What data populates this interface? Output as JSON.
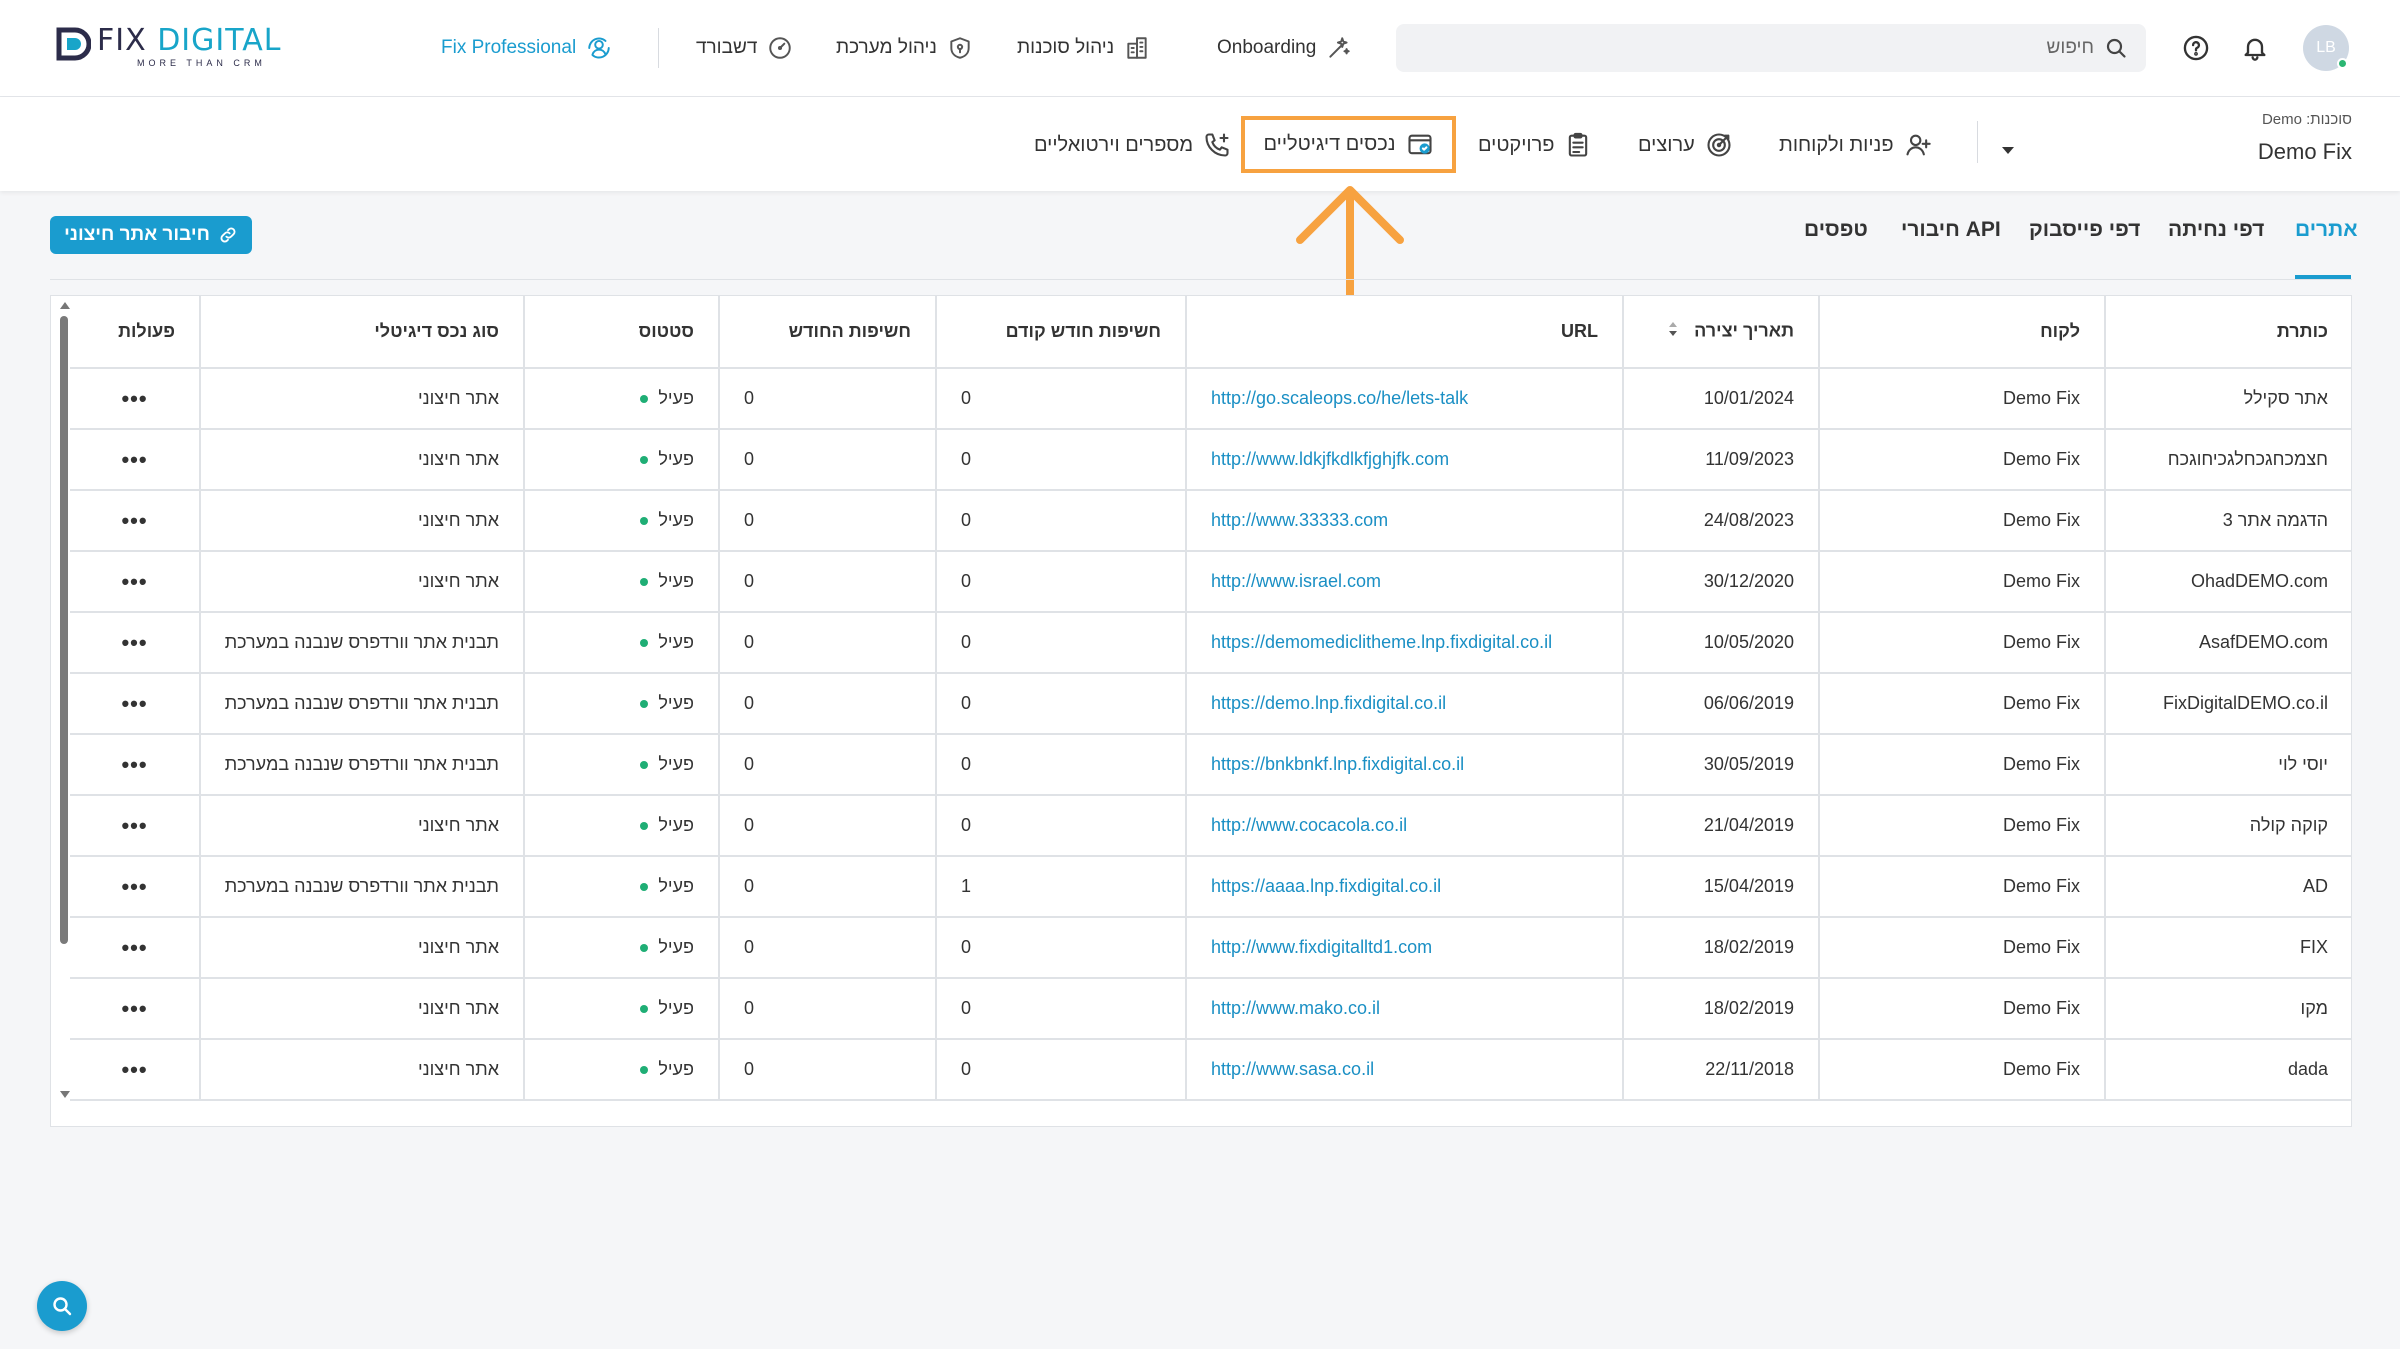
{
  "brand": {
    "name_part1": "FIX",
    "name_part2": "DIGITAL",
    "tagline": "MORE THAN CRM"
  },
  "topnav": {
    "pro_label": "Fix Professional",
    "dashboard_label": "דשבורד",
    "system_label": "ניהול מערכת",
    "agencies_label": "ניהול סוכנות",
    "onboarding_label": "Onboarding"
  },
  "search": {
    "placeholder": "חיפוש"
  },
  "user": {
    "initials": "LB"
  },
  "agency": {
    "label": "סוכנות: Demo",
    "name": "Demo Fix"
  },
  "subnav": {
    "leads_label": "פניות ולקוחות",
    "channels_label": "ערוצים",
    "projects_label": "פרויקטים",
    "assets_label": "נכסים דיגיטליים",
    "virtual_numbers_label": "מספרים וירטואליים"
  },
  "tabs": {
    "sites": "אתרים",
    "landing": "דפי נחיתה",
    "facebook": "דפי פייסבוק",
    "api": "חיבורי API",
    "forms": "טפסים"
  },
  "connect_button": "חיבור אתר חיצוני",
  "table": {
    "headers": {
      "title": "כותרת",
      "client": "לקוח",
      "created": "תאריך יצירה",
      "url": "URL",
      "prev_month": "חשיפות חודש קודם",
      "this_month": "חשיפות החודש",
      "status": "סטטוס",
      "type": "סוג נכס דיגיטלי",
      "actions": "פעולות"
    },
    "rows": [
      {
        "title": "אתר סקילל",
        "client": "Demo Fix",
        "created": "10/01/2024",
        "url": "http://go.scaleops.co/he/lets-talk",
        "prev": "0",
        "cur": "0",
        "status": "פעיל",
        "type": "אתר חיצוני",
        "actions": "•••"
      },
      {
        "title": "חצמכחגכחלגכיחוגכח",
        "client": "Demo Fix",
        "created": "11/09/2023",
        "url": "http://www.ldkjfkdlkfjghjfk.com",
        "prev": "0",
        "cur": "0",
        "status": "פעיל",
        "type": "אתר חיצוני",
        "actions": "•••"
      },
      {
        "title": "הדגמה אתר 3",
        "client": "Demo Fix",
        "created": "24/08/2023",
        "url": "http://www.33333.com",
        "prev": "0",
        "cur": "0",
        "status": "פעיל",
        "type": "אתר חיצוני",
        "actions": "•••"
      },
      {
        "title": "OhadDEMO.com",
        "client": "Demo Fix",
        "created": "30/12/2020",
        "url": "http://www.israel.com",
        "prev": "0",
        "cur": "0",
        "status": "פעיל",
        "type": "אתר חיצוני",
        "actions": "•••"
      },
      {
        "title": "AsafDEMO.com",
        "client": "Demo Fix",
        "created": "10/05/2020",
        "url": "https://demomediclitheme.lnp.fixdigital.co.il",
        "prev": "0",
        "cur": "0",
        "status": "פעיל",
        "type": "תבנית אתר וורדפרס שנבנה במערכת",
        "actions": "•••"
      },
      {
        "title": "FixDigitalDEMO.co.il",
        "client": "Demo Fix",
        "created": "06/06/2019",
        "url": "https://demo.lnp.fixdigital.co.il",
        "prev": "0",
        "cur": "0",
        "status": "פעיל",
        "type": "תבנית אתר וורדפרס שנבנה במערכת",
        "actions": "•••"
      },
      {
        "title": "יוסי לוי",
        "client": "Demo Fix",
        "created": "30/05/2019",
        "url": "https://bnkbnkf.lnp.fixdigital.co.il",
        "prev": "0",
        "cur": "0",
        "status": "פעיל",
        "type": "תבנית אתר וורדפרס שנבנה במערכת",
        "actions": "•••"
      },
      {
        "title": "קוקה קולה",
        "client": "Demo Fix",
        "created": "21/04/2019",
        "url": "http://www.cocacola.co.il",
        "prev": "0",
        "cur": "0",
        "status": "פעיל",
        "type": "אתר חיצוני",
        "actions": "•••"
      },
      {
        "title": "AD",
        "client": "Demo Fix",
        "created": "15/04/2019",
        "url": "https://aaaa.lnp.fixdigital.co.il",
        "prev": "1",
        "cur": "0",
        "status": "פעיל",
        "type": "תבנית אתר וורדפרס שנבנה במערכת",
        "actions": "•••"
      },
      {
        "title": "FIX",
        "client": "Demo Fix",
        "created": "18/02/2019",
        "url": "http://www.fixdigitalltd1.com",
        "prev": "0",
        "cur": "0",
        "status": "פעיל",
        "type": "אתר חיצוני",
        "actions": "•••"
      },
      {
        "title": "מקו",
        "client": "Demo Fix",
        "created": "18/02/2019",
        "url": "http://www.mako.co.il",
        "prev": "0",
        "cur": "0",
        "status": "פעיל",
        "type": "אתר חיצוני",
        "actions": "•••"
      },
      {
        "title": "dada",
        "client": "Demo Fix",
        "created": "22/11/2018",
        "url": "http://www.sasa.co.il",
        "prev": "0",
        "cur": "0",
        "status": "פעיל",
        "type": "אתר חיצוני",
        "actions": "•••"
      }
    ]
  },
  "colors": {
    "accent": "#1a9ccf",
    "highlight": "#f7a240",
    "status_active": "#1fae75"
  }
}
